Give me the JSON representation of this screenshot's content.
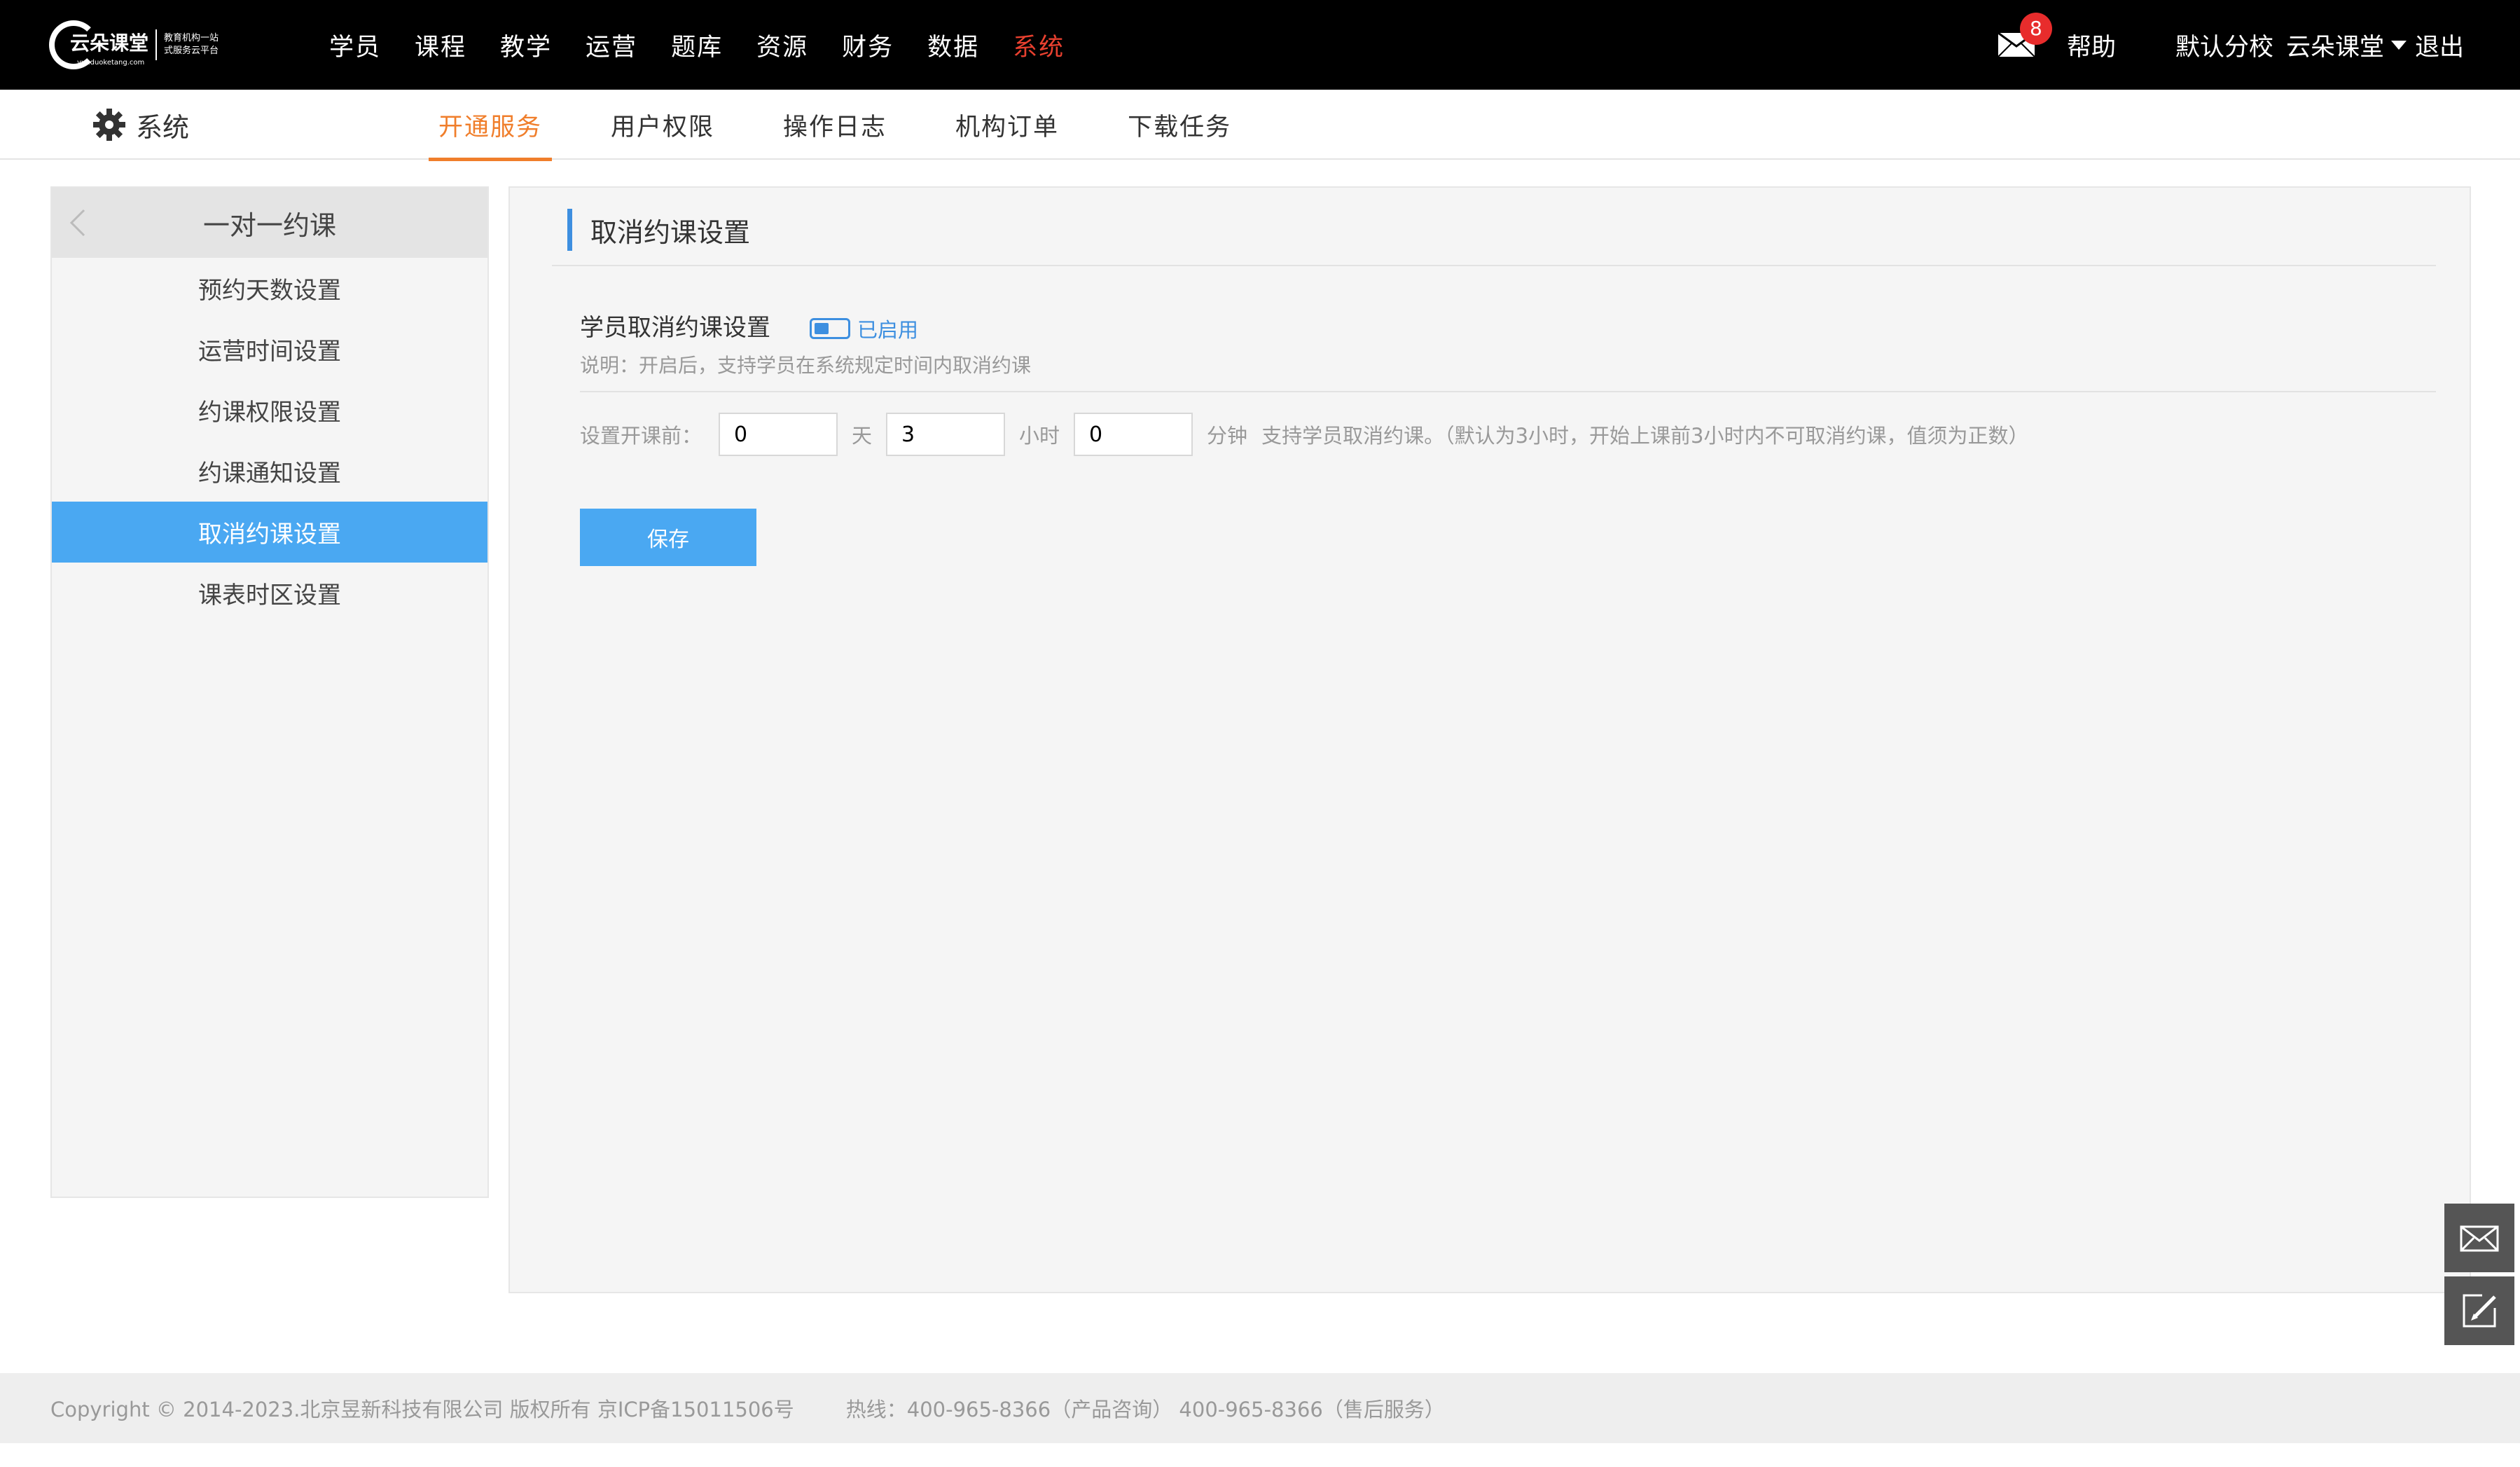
{
  "header": {
    "logo_text": "云朵课堂",
    "logo_url": "yunduoketang.com",
    "logo_slogan_1": "教育机构一站",
    "logo_slogan_2": "式服务云平台",
    "nav": [
      {
        "label": "学员"
      },
      {
        "label": "课程"
      },
      {
        "label": "教学"
      },
      {
        "label": "运营"
      },
      {
        "label": "题库"
      },
      {
        "label": "资源"
      },
      {
        "label": "财务"
      },
      {
        "label": "数据"
      },
      {
        "label": "系统",
        "active": true
      }
    ],
    "mail_badge": "8",
    "help": "帮助",
    "branch": "默认分校",
    "user": "云朵课堂",
    "logout": "退出"
  },
  "subbar": {
    "section": "系统",
    "tabs": [
      {
        "label": "开通服务",
        "active": true
      },
      {
        "label": "用户权限"
      },
      {
        "label": "操作日志"
      },
      {
        "label": "机构订单"
      },
      {
        "label": "下载任务"
      }
    ]
  },
  "sidebar": {
    "title": "一对一约课",
    "items": [
      {
        "label": "预约天数设置"
      },
      {
        "label": "运营时间设置"
      },
      {
        "label": "约课权限设置"
      },
      {
        "label": "约课通知设置"
      },
      {
        "label": "取消约课设置",
        "active": true
      },
      {
        "label": "课表时区设置"
      }
    ]
  },
  "main": {
    "title": "取消约课设置",
    "setting_label": "学员取消约课设置",
    "toggle_status": "已启用",
    "toggle_on": true,
    "description": "说明：开启后，支持学员在系统规定时间内取消约课",
    "time_label": "设置开课前：",
    "days_value": "0",
    "days_unit": "天",
    "hours_value": "3",
    "hours_unit": "小时",
    "minutes_value": "0",
    "minutes_unit": "分钟",
    "note": "支持学员取消约课。（默认为3小时，开始上课前3小时内不可取消约课，值须为正数）",
    "save": "保存"
  },
  "footer": {
    "copyright": "Copyright © 2014-2023.北京昱新科技有限公司 版权所有 京ICP备15011506号",
    "hotline": "热线：400-965-8366（产品咨询） 400-965-8366（售后服务）"
  },
  "colors": {
    "accent_blue": "#4aa8f2",
    "active_tab": "#f07e2b",
    "active_nav": "#e8402f",
    "badge": "#e82c2c"
  }
}
